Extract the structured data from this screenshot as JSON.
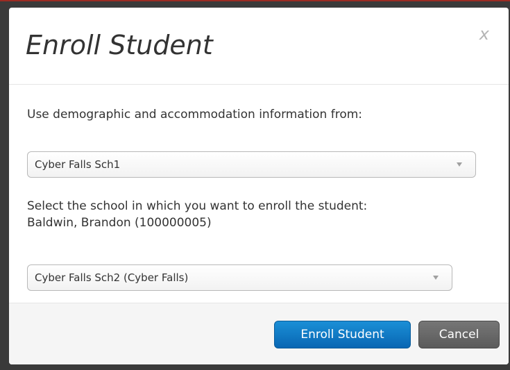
{
  "modal": {
    "title": "Enroll Student",
    "close_label": "x"
  },
  "form": {
    "source_label": "Use demographic and accommodation information from:",
    "source_select": {
      "value": "Cyber Falls Sch1"
    },
    "target_label": "Select the school in which you want to enroll the student:",
    "student_name": "Baldwin, Brandon (100000005)",
    "target_select": {
      "value": "Cyber Falls Sch2 (Cyber Falls)"
    }
  },
  "footer": {
    "enroll_label": "Enroll Student",
    "cancel_label": "Cancel"
  },
  "colors": {
    "primary_button": "#0b74c4",
    "secondary_button": "#666666",
    "backdrop_accent": "#9b2b22"
  }
}
